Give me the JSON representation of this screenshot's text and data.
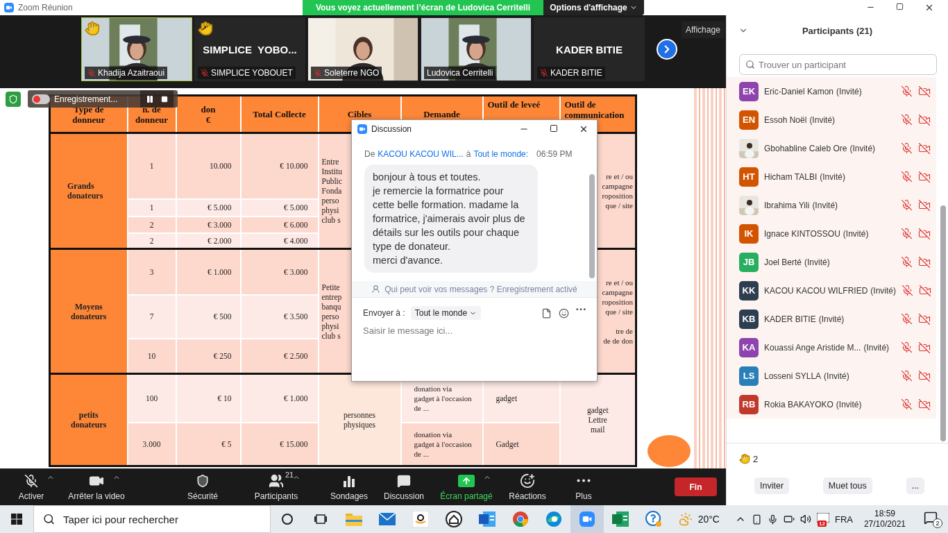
{
  "title_bar": {
    "app_title": "Zoom Réunion",
    "share_banner": "Vous voyez actuellement l’écran de Ludovica Cerritelli",
    "view_options": "Options d'affichage"
  },
  "video_strip": {
    "tiles": [
      {
        "kind": "picture",
        "name": "Khadija Azaitraoui",
        "hand_raised": true,
        "muted": true,
        "speaking": true
      },
      {
        "kind": "name",
        "display": "SIMPLICE  YOBO...",
        "name": "SIMPLICE YOBOUET",
        "hand_raised": true,
        "muted": true,
        "speaking": false
      },
      {
        "kind": "picture",
        "name": "Soleterre NGO",
        "hand_raised": false,
        "muted": true,
        "speaking": false
      },
      {
        "kind": "picture",
        "name": "Ludovica Cerritelli",
        "hand_raised": false,
        "muted": false,
        "speaking": false
      },
      {
        "kind": "name",
        "display": "KADER BITIE",
        "name": "KADER BITIE",
        "hand_raised": false,
        "muted": true,
        "speaking": false
      }
    ],
    "view_button": "Affichage"
  },
  "recording": {
    "label": "Enregistrement..."
  },
  "slide": {
    "table": {
      "columns": [
        "Type de\ndonneur",
        "n. de\ndonneur",
        "don\n€",
        "Total Collecte",
        "Cibles",
        "Demande",
        "Outil de leveé",
        "Outil de\ncommunication"
      ],
      "groups": [
        {
          "type": "Grands\ndonateurs",
          "cibles": "Entre\nInstitu\nPublic\nFonda\nperso\nphysi\nclub s",
          "communication": "re et / ou\ncampagne\nroposition\nque / site",
          "rows": [
            {
              "n": "1",
              "don": "10.000",
              "total": "€ 10.000"
            },
            {
              "n": "1",
              "don": "€ 5.000",
              "total": "€ 5.000"
            },
            {
              "n": "2",
              "don": "€ 3.000",
              "total": "€ 6.000"
            },
            {
              "n": "2",
              "don": "€ 2.000",
              "total": "€ 4.000"
            }
          ]
        },
        {
          "type": "Moyens\ndonateurs",
          "cibles": "Petite\nentrep\nbanqu\nperso\nphysi\nclub s",
          "communication": "re et / ou\ncampagne\nroposition\nque / site\n\ntre de\nde de don",
          "rows": [
            {
              "n": "3",
              "don": "€ 1.000",
              "total": "€ 3.000"
            },
            {
              "n": "7",
              "don": "€ 500",
              "total": "€ 3.500"
            },
            {
              "n": "10",
              "don": "€ 250",
              "total": "€ 2.500"
            }
          ]
        },
        {
          "type": "petits\ndonateurs",
          "cibles": "personnes\nphysiques",
          "communication": "gadget\nLettre\nmail",
          "rows": [
            {
              "n": "100",
              "don": "€ 10",
              "total": "€ 1.000",
              "demande": "donation via\ngadget à l'occasion\nde ...",
              "outil": "gadget"
            },
            {
              "n": "3.000",
              "don": "€ 5",
              "total": "€ 15.000",
              "demande": "donation via\ngadget à l'occasion\nde ...",
              "outil": "Gadget"
            }
          ]
        }
      ]
    }
  },
  "chat": {
    "title": "Discussion",
    "meta": {
      "from_label": "De",
      "sender": "KACOU KACOU WIL...",
      "to_label": "à",
      "recipient": "Tout le monde:",
      "time": "06:59 PM"
    },
    "message": "bonjour à tous et toutes.\nje remercie la formatrice pour cette belle formation. madame la formatrice, j'aimerais avoir plus de détails sur les outils pour chaque type de donateur.\nmerci d'avance.",
    "notice": "Qui peut voir vos messages ? Enregistrement activé",
    "send_to_label": "Envoyer à :",
    "send_to": "Tout le monde",
    "placeholder": "Saisir le message ici..."
  },
  "participants": {
    "title": "Participants (21)",
    "search_placeholder": "Trouver un participant",
    "list": [
      {
        "kind": "initials",
        "initials": "EK",
        "color": "#8e44ad",
        "name": "Eric-Daniel Kamon",
        "role": "(Invité)",
        "muted": true,
        "video_off": true
      },
      {
        "kind": "initials",
        "initials": "EN",
        "color": "#d35400",
        "name": "Essoh Noël",
        "role": "(Invité)",
        "muted": true,
        "video_off": true
      },
      {
        "kind": "picture",
        "name": "Gbohabline Caleb Ore",
        "role": "(Invité)",
        "muted": true,
        "video_off": true
      },
      {
        "kind": "initials",
        "initials": "HT",
        "color": "#d35400",
        "name": "Hicham TALBI",
        "role": "(Invité)",
        "muted": true,
        "video_off": true
      },
      {
        "kind": "picture",
        "name": "Ibrahima Yili",
        "role": "(Invité)",
        "muted": true,
        "video_off": true
      },
      {
        "kind": "initials",
        "initials": "IK",
        "color": "#d35400",
        "name": "Ignace KINTOSSOU",
        "role": "(Invité)",
        "muted": true,
        "video_off": true
      },
      {
        "kind": "initials",
        "initials": "JB",
        "color": "#27ae60",
        "name": "Joel Berté",
        "role": "(Invité)",
        "muted": true,
        "video_off": true
      },
      {
        "kind": "initials",
        "initials": "KK",
        "color": "#2c3e50",
        "name": "KACOU KACOU WILFRIED",
        "role": "(Invité)",
        "muted": true,
        "video_off": true
      },
      {
        "kind": "initials",
        "initials": "KB",
        "color": "#2c3e50",
        "name": "KADER BITIE",
        "role": "(Invité)",
        "muted": true,
        "video_off": true
      },
      {
        "kind": "initials",
        "initials": "KA",
        "color": "#8e44ad",
        "name": "Kouassi Ange Aristide M...",
        "role": "(Invité)",
        "muted": true,
        "video_off": true
      },
      {
        "kind": "initials",
        "initials": "LS",
        "color": "#2980b9",
        "name": "Losseni SYLLA",
        "role": "(Invité)",
        "muted": true,
        "video_off": true
      },
      {
        "kind": "initials",
        "initials": "RB",
        "color": "#c0392b",
        "name": "Rokia BAKAYOKO",
        "role": "(Invité)",
        "muted": true,
        "video_off": true
      }
    ],
    "raised_hands": "2",
    "buttons": [
      "Inviter",
      "Muet tous",
      "..."
    ]
  },
  "toolbar": {
    "items": [
      {
        "kind": "mic",
        "label": "Activer",
        "muted": true,
        "caret": true,
        "active": false
      },
      {
        "kind": "video",
        "label": "Arrêter la video",
        "caret": true,
        "active": false
      },
      {
        "kind": "security",
        "label": "Sécurité",
        "caret": false,
        "active": false
      },
      {
        "kind": "participants",
        "label": "Participants",
        "count": "21",
        "caret": true,
        "active": false
      },
      {
        "kind": "polls",
        "label": "Sondages",
        "caret": false,
        "active": false
      },
      {
        "kind": "chat",
        "label": "Discussion",
        "caret": false,
        "active": false
      },
      {
        "kind": "share",
        "label": "Écran partagé",
        "caret": true,
        "active": true
      },
      {
        "kind": "reactions",
        "label": "Réactions",
        "caret": false,
        "active": false
      },
      {
        "kind": "more",
        "label": "Plus",
        "caret": false,
        "active": false
      }
    ],
    "end_button": "Fin"
  },
  "taskbar": {
    "search_placeholder": "Taper ici pour rechercher",
    "temperature": "20°C",
    "calendar_badge": "12",
    "language": "FRA",
    "time": "18:59",
    "date": "27/10/2021",
    "notifications": "2"
  }
}
